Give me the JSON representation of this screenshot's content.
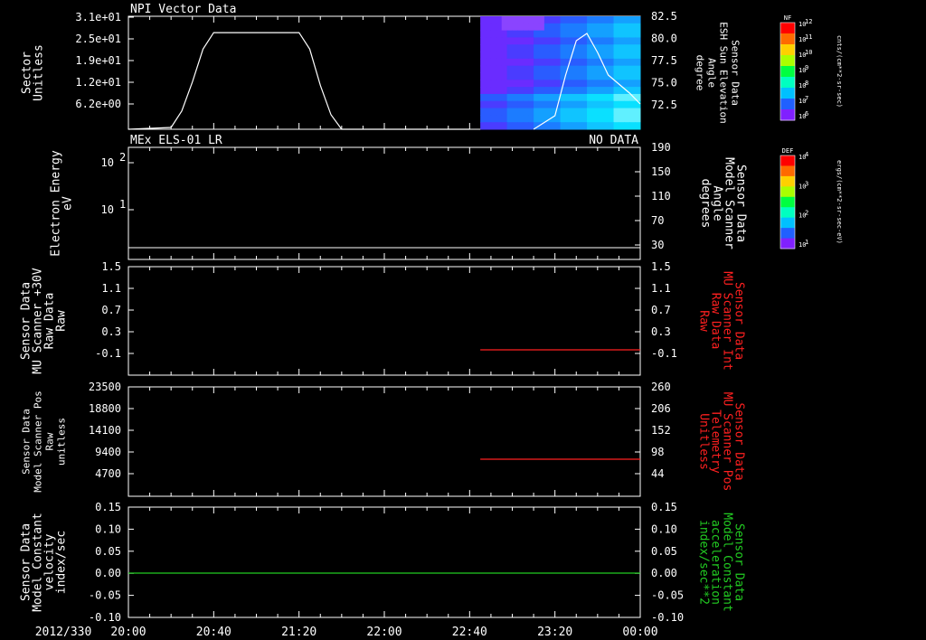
{
  "colors": {
    "background": "#000000",
    "axis": "#ffffff",
    "red": "#ff2020",
    "green": "#22cc22"
  },
  "header": {
    "date_label": "2012/330"
  },
  "time_axis": {
    "ticks": [
      "20:00",
      "20:40",
      "21:20",
      "22:00",
      "22:40",
      "23:20",
      "00:00"
    ]
  },
  "chart_data": [
    {
      "type": "heatmap",
      "title": "NPI Vector Data",
      "ylabel": [
        "Sector",
        "Unitless"
      ],
      "yticks": [
        "3.1e+01",
        "2.5e+01",
        "1.9e+01",
        "1.2e+01",
        "6.2e+00"
      ],
      "ylim": [
        0,
        31
      ],
      "right_ylabel": [
        "Sensor Data",
        "ESH Sun Elevation",
        "Angle",
        "degree"
      ],
      "right_yticks": [
        "82.5",
        "80.0",
        "77.5",
        "75.0",
        "72.5"
      ],
      "right_ylim": [
        70,
        82.5
      ],
      "heatmap_time_range": [
        "22:45",
        "00:00"
      ],
      "colorbar": {
        "name": "NF",
        "top": "10^12",
        "labels": [
          "10^11",
          "10^10",
          "10^9",
          "10^8",
          "10^7",
          "10^6"
        ],
        "unit": "cnts/(cm**2-sr-sec)"
      },
      "series": [
        {
          "axis": "left",
          "x": [
            "20:00",
            "20:20",
            "20:25",
            "20:30",
            "20:35",
            "20:40",
            "20:45",
            "21:00",
            "21:15",
            "21:20",
            "21:25",
            "21:30",
            "21:35",
            "21:40",
            "21:45",
            "22:40"
          ],
          "values": [
            0,
            0.5,
            5,
            13,
            22,
            26.5,
            26.5,
            26.5,
            26.5,
            26.5,
            22,
            12,
            4,
            0,
            0,
            0
          ]
        },
        {
          "axis": "right",
          "x": [
            "23:10",
            "23:20",
            "23:25",
            "23:30",
            "23:35",
            "23:40",
            "23:45",
            "23:50",
            "23:55",
            "00:00"
          ],
          "values": [
            70,
            71.5,
            76,
            79.8,
            80.6,
            78.5,
            76,
            75,
            74,
            72.8
          ]
        }
      ]
    },
    {
      "type": "line",
      "title": "MEx ELS-01 LR",
      "status": "NO DATA",
      "ylabel": [
        "Electron Energy",
        "eV"
      ],
      "yticks": [
        "10^2",
        "10^1"
      ],
      "right_ylabel": [
        "Sensor Data",
        "Model Scanner",
        "Angle",
        "degrees"
      ],
      "right_yticks": [
        "190",
        "150",
        "110",
        "70",
        "30"
      ],
      "right_ylim": [
        10,
        190
      ],
      "colorbar": {
        "name": "DEF",
        "top": "10^4",
        "labels": [
          "10^3",
          "10^2",
          "10^1"
        ],
        "unit": "ergs/(cm**2-sr-sec-eV)"
      },
      "series": [
        {
          "axis": "right",
          "x": [
            "20:00",
            "00:00"
          ],
          "values": [
            10,
            10
          ]
        }
      ]
    },
    {
      "type": "line",
      "ylabel": [
        "Sensor Data",
        "MU Scanner +30V",
        "Raw Data",
        "Raw"
      ],
      "yticks": [
        "1.5",
        "1.1",
        "0.7",
        "0.3",
        "-0.1"
      ],
      "ylim": [
        -0.5,
        1.5
      ],
      "right_ylabel": [
        "Sensor Data",
        "MU Scanner Int",
        "Raw Data",
        "Raw"
      ],
      "right_yticks": [
        "1.5",
        "1.1",
        "0.7",
        "0.3",
        "-0.1"
      ],
      "series": [
        {
          "axis": "right",
          "color": "red",
          "x": [
            "22:45",
            "00:00"
          ],
          "values": [
            0,
            0
          ]
        }
      ]
    },
    {
      "type": "line",
      "ylabel": [
        "Sensor Data",
        "Model Scanner Pos",
        "Raw",
        "unitless"
      ],
      "yticks": [
        "23500",
        "18800",
        "14100",
        "9400",
        "4700"
      ],
      "ylim": [
        0,
        23500
      ],
      "right_ylabel": [
        "Sensor Data",
        "MU Scanner Pos",
        "Telemetry",
        "Unitless"
      ],
      "right_yticks": [
        "260",
        "206",
        "152",
        "98",
        "44"
      ],
      "right_ylim": [
        -10,
        260
      ],
      "series": [
        {
          "axis": "right",
          "color": "red",
          "x": [
            "22:45",
            "00:00"
          ],
          "values": [
            80,
            80
          ]
        }
      ]
    },
    {
      "type": "line",
      "ylabel": [
        "Sensor Data",
        "Model Constant",
        "velocity",
        "index/sec"
      ],
      "yticks": [
        "0.15",
        "0.10",
        "0.05",
        "0.00",
        "-0.05",
        "-0.10"
      ],
      "ylim": [
        -0.1,
        0.15
      ],
      "right_ylabel": [
        "Sensor Data",
        "Model Constant",
        "acceleration",
        "index/sec**2"
      ],
      "right_yticks": [
        "0.15",
        "0.10",
        "0.05",
        "0.00",
        "-0.05",
        "-0.10"
      ],
      "series": [
        {
          "axis": "left",
          "color": "green",
          "x": [
            "20:00",
            "00:00"
          ],
          "values": [
            0,
            0
          ]
        }
      ]
    }
  ]
}
